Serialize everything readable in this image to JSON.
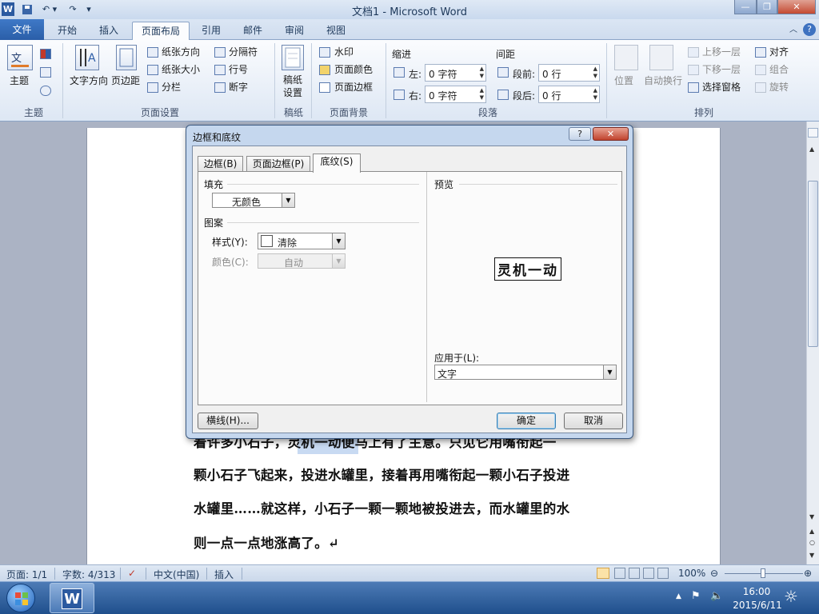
{
  "titlebar": {
    "title": "文档1 - Microsoft Word",
    "app_icon": "W",
    "minimize": "—",
    "restore": "❐",
    "close": "✕"
  },
  "tabs": [
    "文件",
    "开始",
    "插入",
    "页面布局",
    "引用",
    "邮件",
    "审阅",
    "视图"
  ],
  "ribbon": {
    "theme": {
      "label": "主题",
      "group": "主题"
    },
    "page_setup": {
      "text_direction": "文字方向",
      "margins": "页边距",
      "orientation": "纸张方向",
      "size": "纸张大小",
      "columns": "分栏",
      "breaks": "分隔符",
      "line_numbers": "行号",
      "hyphenation": "断字",
      "group": "页面设置"
    },
    "draft": {
      "label": "稿纸\n设置",
      "group": "稿纸"
    },
    "page_bg": {
      "watermark": "水印",
      "page_color": "页面颜色",
      "page_borders": "页面边框",
      "group": "页面背景"
    },
    "paragraph": {
      "indent": "缩进",
      "spacing": "间距",
      "left": "左:",
      "right": "右:",
      "before": "段前:",
      "after": "段后:",
      "left_val": "0 字符",
      "right_val": "0 字符",
      "before_val": "0 行",
      "after_val": "0 行",
      "group": "段落"
    },
    "arrange": {
      "position": "位置",
      "wrap": "自动换行",
      "bring_forward": "上移一层",
      "send_backward": "下移一层",
      "selection_pane": "选择窗格",
      "align": "对齐",
      "group_btn": "组合",
      "rotate": "旋转",
      "group": "排列"
    }
  },
  "document": {
    "lines": [
      "着许多小石子，灵机一动便马上有了主意。只见它用嘴衔起一",
      "颗小石子飞起来，投进水罐里，接着再用嘴衔起一颗小石子投进",
      "水罐里……就这样，小石子一颗一颗地被投进去，而水罐里的水",
      "则一点一点地涨高了。↵"
    ]
  },
  "dialog": {
    "title": "边框和底纹",
    "help": "?",
    "close": "✕",
    "tabs": [
      "边框(B)",
      "页面边框(P)",
      "底纹(S)"
    ],
    "fill_label": "填充",
    "fill_value": "无颜色",
    "pattern_label": "图案",
    "style_label": "样式(Y):",
    "style_value": "清除",
    "color_label": "颜色(C):",
    "color_value": "自动",
    "preview_label": "预览",
    "preview_sample": "灵机一动",
    "apply_label": "应用于(L):",
    "apply_value": "文字",
    "hline_button": "横线(H)...",
    "ok": "确定",
    "cancel": "取消"
  },
  "status": {
    "page": "页面: 1/1",
    "words": "字数: 4/313",
    "lang": "中文(中国)",
    "mode": "插入",
    "zoom": "100%"
  },
  "taskbar": {
    "time": "16:00",
    "date": "2015/6/11"
  }
}
